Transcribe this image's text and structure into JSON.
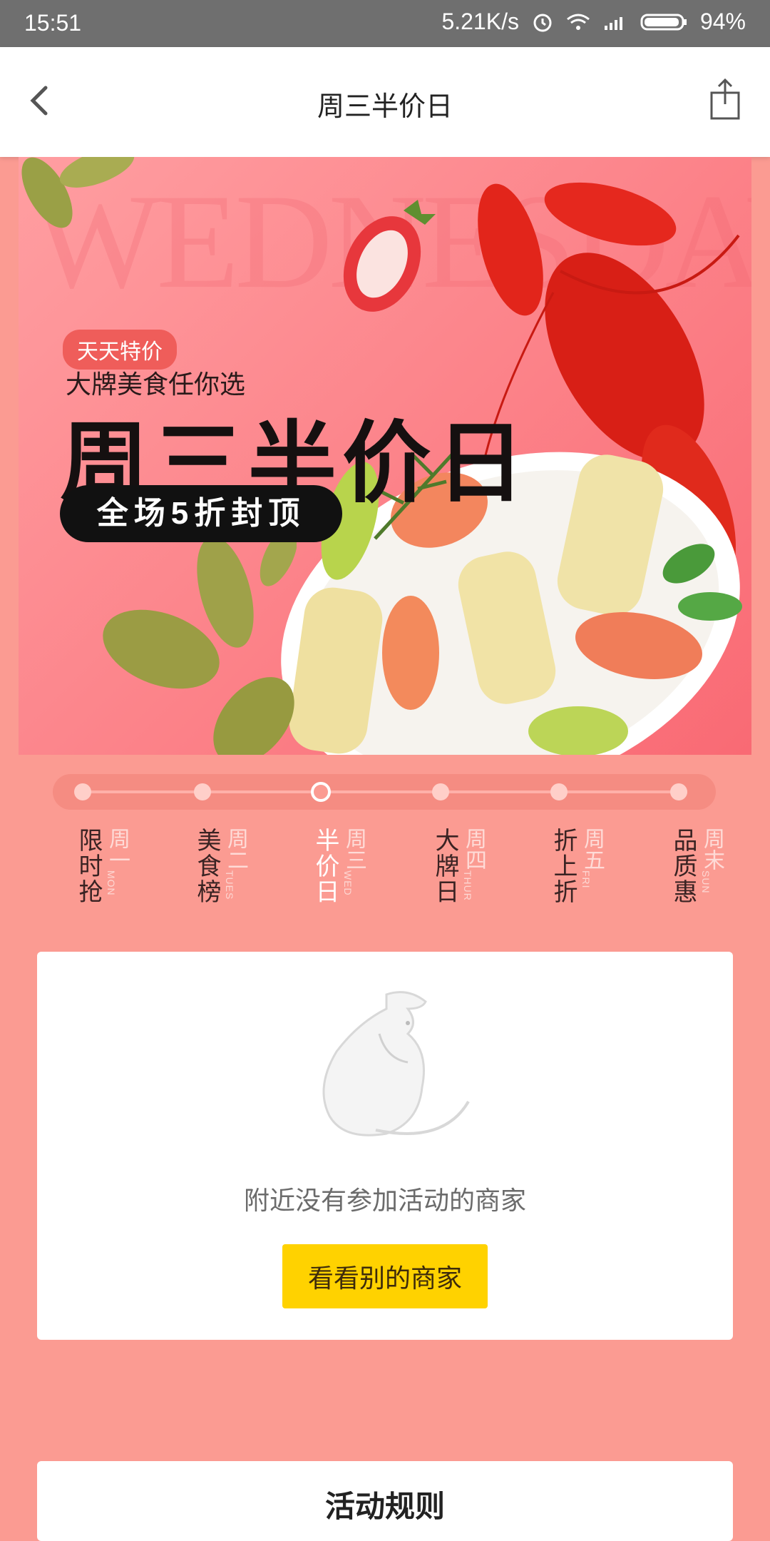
{
  "statusbar": {
    "time": "15:51",
    "speed": "5.21K/s",
    "battery": "94%"
  },
  "nav": {
    "title": "周三半价日"
  },
  "banner": {
    "watermark": "WEDNESDAY",
    "tag": "天天特价",
    "subtitle": "大牌美食任你选",
    "headline": "周三半价日",
    "pill": "全场5折封顶"
  },
  "days": [
    {
      "title": "限时抢",
      "weekday": "周一",
      "en": "MON"
    },
    {
      "title": "美食榜",
      "weekday": "周二",
      "en": "TUES"
    },
    {
      "title": "半价日",
      "weekday": "周三",
      "en": "WED"
    },
    {
      "title": "大牌日",
      "weekday": "周四",
      "en": "THUR"
    },
    {
      "title": "折上折",
      "weekday": "周五",
      "en": "FRI"
    },
    {
      "title": "品质惠",
      "weekday": "周末",
      "en": "SUN"
    }
  ],
  "empty": {
    "message": "附近没有参加活动的商家",
    "button": "看看别的商家"
  },
  "rules": {
    "title": "活动规则"
  }
}
